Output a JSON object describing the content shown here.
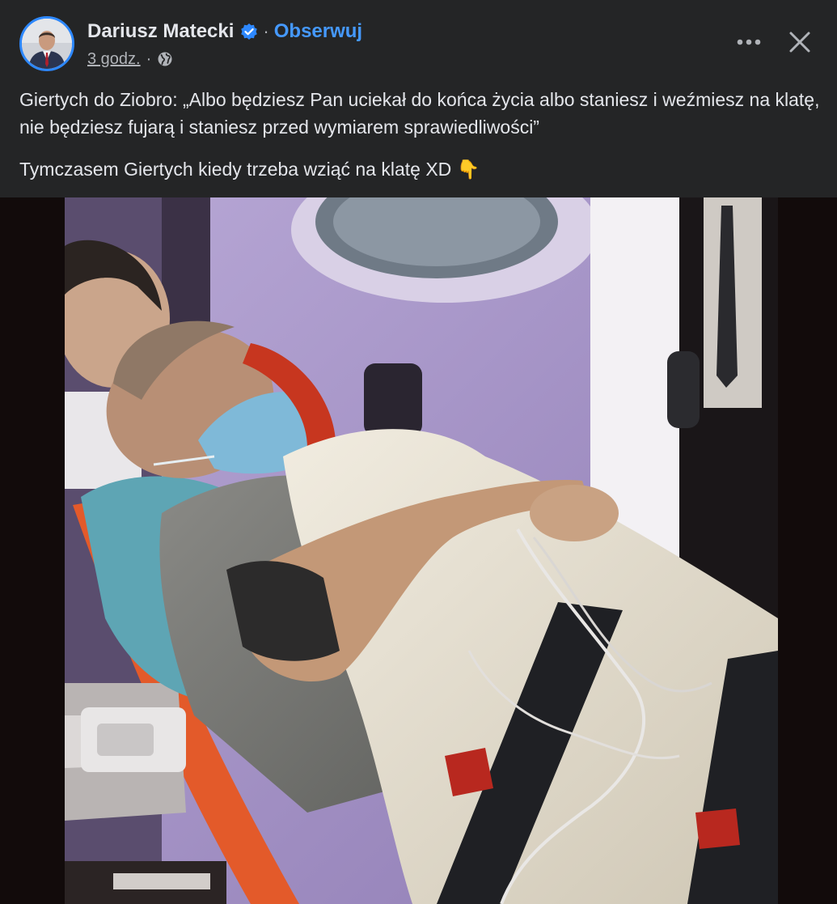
{
  "author": {
    "name": "Dariusz Matecki",
    "verified_icon": "verified-badge-icon",
    "follow_label": "Obserwuj"
  },
  "meta": {
    "timestamp": "3 godz.",
    "separator": "·",
    "audience_icon": "globe-icon"
  },
  "actions": {
    "more_icon": "more-horizontal-icon",
    "close_icon": "close-icon"
  },
  "post": {
    "text_line_1": "Giertych do Ziobro: „Albo będziesz Pan uciekał do końca życia albo staniesz i weźmiesz na klatę, nie będziesz fujarą i staniesz przed wymiarem sprawiedliwości”",
    "text_line_2": "Tymczasem Giertych kiedy trzeba wziąć na klatę XD 👇"
  },
  "colors": {
    "background": "#242526",
    "text_primary": "#e4e6eb",
    "text_secondary": "#b0b3b8",
    "link_blue": "#4599ff",
    "verified_blue": "#2d88ff"
  }
}
